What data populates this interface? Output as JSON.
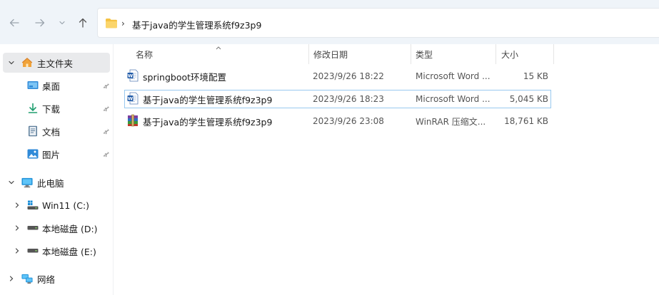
{
  "address": {
    "path": "基于java的学生管理系统f9z3p9",
    "separator": "›"
  },
  "nav": {
    "back": "back",
    "forward": "forward",
    "recent": "recent-locations",
    "up": "up"
  },
  "sidebar": {
    "items": [
      {
        "label": "主文件夹",
        "icon": "home-icon",
        "chevron": "expanded",
        "pinned": false
      },
      {
        "label": "桌面",
        "icon": "desktop-icon",
        "pinned": true
      },
      {
        "label": "下载",
        "icon": "download-icon",
        "pinned": true
      },
      {
        "label": "文档",
        "icon": "document-icon",
        "pinned": true
      },
      {
        "label": "图片",
        "icon": "pictures-icon",
        "pinned": true
      },
      {
        "label": "此电脑",
        "icon": "computer-icon",
        "chevron": "expanded"
      },
      {
        "label": "Win11 (C:)",
        "icon": "windows-drive-icon",
        "chevron": "collapsed"
      },
      {
        "label": "本地磁盘 (D:)",
        "icon": "drive-icon",
        "chevron": "collapsed"
      },
      {
        "label": "本地磁盘 (E:)",
        "icon": "drive-icon",
        "chevron": "collapsed"
      },
      {
        "label": "网络",
        "icon": "network-icon",
        "chevron": "collapsed"
      }
    ]
  },
  "columns": {
    "name": "名称",
    "date": "修改日期",
    "type": "类型",
    "size": "大小"
  },
  "files": [
    {
      "name": "springboot环境配置",
      "date": "2023/9/26 18:22",
      "type": "Microsoft Word ...",
      "size": "15 KB",
      "icon": "word-doc-icon"
    },
    {
      "name": "基于java的学生管理系统f9z3p9",
      "date": "2023/9/26 18:23",
      "type": "Microsoft Word ...",
      "size": "5,045 KB",
      "icon": "word-doc-icon"
    },
    {
      "name": "基于java的学生管理系统f9z3p9",
      "date": "2023/9/26 23:08",
      "type": "WinRAR 压缩文...",
      "size": "18,761 KB",
      "icon": "winrar-archive-icon"
    }
  ],
  "colors": {
    "navbar_bg": "#eff4f9",
    "folder": "#f5c242",
    "selection_outline": "#99c9ef",
    "sidebar_selected": "#e9eaec"
  }
}
